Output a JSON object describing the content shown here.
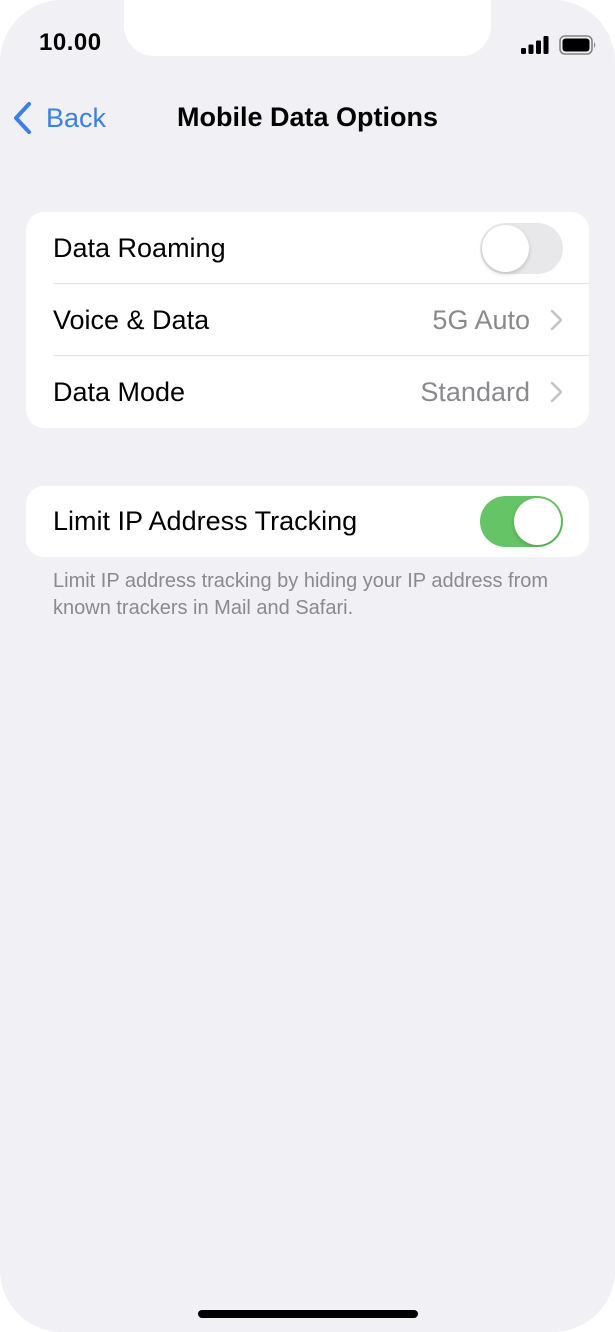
{
  "status_bar": {
    "time": "10.00",
    "signal_icon": "signal-bars-icon",
    "battery_icon": "battery-icon"
  },
  "nav": {
    "back_label": "Back",
    "title": "Mobile Data Options",
    "back_icon": "chevron-left-icon"
  },
  "colors": {
    "background": "#f0f0f5",
    "accent": "#3a80e5",
    "toggle_on": "#65c466",
    "toggle_off": "#e8e8ea",
    "secondary_text": "#8a8a8e"
  },
  "settings": {
    "data_roaming": {
      "label": "Data Roaming",
      "enabled": false
    },
    "voice_data": {
      "label": "Voice & Data",
      "value": "5G Auto"
    },
    "data_mode": {
      "label": "Data Mode",
      "value": "Standard"
    },
    "limit_ip_tracking": {
      "label": "Limit IP Address Tracking",
      "enabled": true,
      "footer": "Limit IP address tracking by hiding your IP address from known trackers in Mail and Safari."
    }
  }
}
